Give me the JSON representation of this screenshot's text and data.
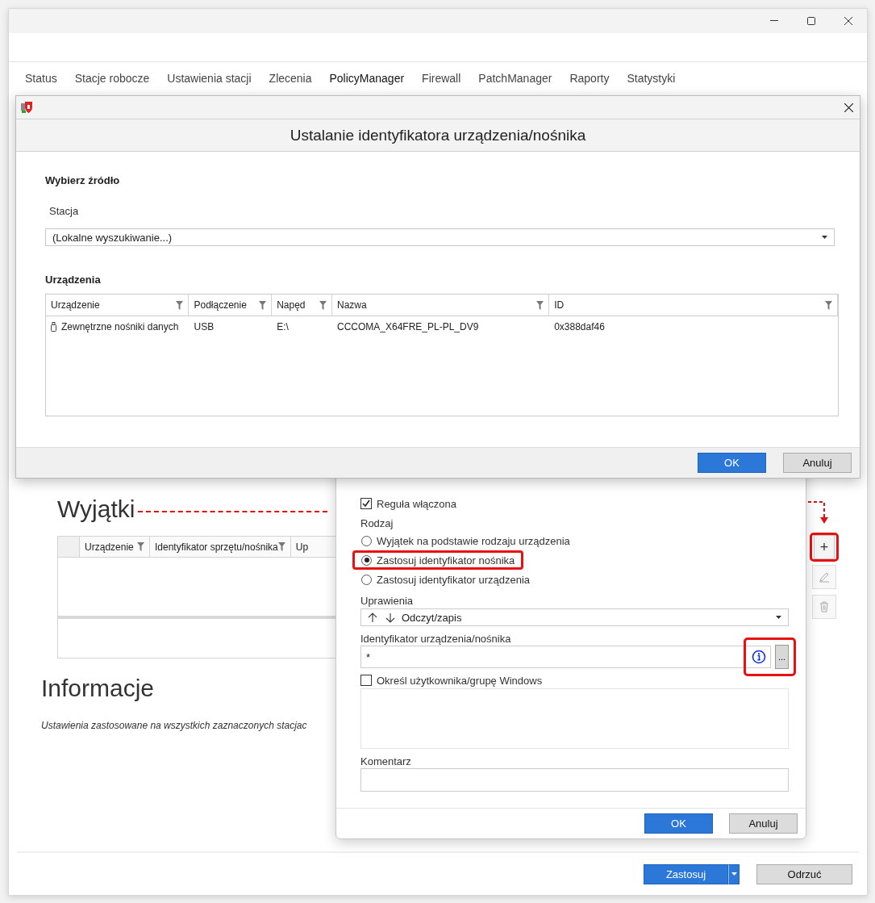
{
  "main_window": {
    "tabs": [
      {
        "label": "Status",
        "selected": false
      },
      {
        "label": "Stacje robocze",
        "selected": false
      },
      {
        "label": "Ustawienia stacji",
        "selected": false
      },
      {
        "label": "Zlecenia",
        "selected": false
      },
      {
        "label": "PolicyManager",
        "selected": true
      },
      {
        "label": "Firewall",
        "selected": false
      },
      {
        "label": "PatchManager",
        "selected": false
      },
      {
        "label": "Raporty",
        "selected": false
      },
      {
        "label": "Statystyki",
        "selected": false
      }
    ],
    "exceptions": {
      "title": "Wyjątki",
      "columns": [
        "Urządzenie",
        "Identyfikator sprzętu/nośnika",
        "Up"
      ],
      "side_buttons": [
        {
          "kind": "add",
          "label": "+",
          "disabled": false,
          "highlighted": true
        },
        {
          "kind": "edit",
          "disabled": true,
          "highlighted": false
        },
        {
          "kind": "delete",
          "disabled": true,
          "highlighted": false
        }
      ]
    },
    "info": {
      "title": "Informacje",
      "text": "Ustawienia zastosowane na wszystkich zaznaczonych stacjac"
    },
    "apply_button": "Zastosuj",
    "discard_button": "Odrzuć"
  },
  "properties_dialog": {
    "rule_enabled": {
      "label": "Reguła włączona",
      "checked": true
    },
    "type_label": "Rodzaj",
    "type_options": [
      {
        "label": "Wyjątek na podstawie rodzaju urządzenia",
        "selected": false,
        "highlighted": false
      },
      {
        "label": "Zastosuj identyfikator nośnika",
        "selected": true,
        "highlighted": true
      },
      {
        "label": "Zastosuj identyfikator urządzenia",
        "selected": false,
        "highlighted": false
      }
    ],
    "permissions": {
      "label": "Uprawienia",
      "value": "Odczyt/zapis"
    },
    "identifier": {
      "label": "Identyfikator urządzenia/nośnika",
      "value": "*",
      "browse_button": "...",
      "buttons_highlighted": true
    },
    "windows_user": {
      "label": "Określ użytkownika/grupę Windows",
      "checked": false
    },
    "comment": {
      "label": "Komentarz"
    },
    "ok_button": "OK",
    "cancel_button": "Anuluj"
  },
  "identifier_dialog": {
    "title": "Ustalanie identyfikatora urządzenia/nośnika",
    "source_heading": "Wybierz źródło",
    "station_label": "Stacja",
    "station_value": "(Lokalne wyszukiwanie...)",
    "devices_heading": "Urządzenia",
    "columns": [
      "Urządzenie",
      "Podłączenie",
      "Napęd",
      "Nazwa",
      "ID"
    ],
    "rows": [
      {
        "cells": [
          "Zewnętrzne nośniki danych",
          "USB",
          "E:\\",
          "CCCOMA_X64FRE_PL-PL_DV9",
          "0x388daf46"
        ]
      }
    ],
    "ok_button": "OK",
    "cancel_button": "Anuluj"
  }
}
